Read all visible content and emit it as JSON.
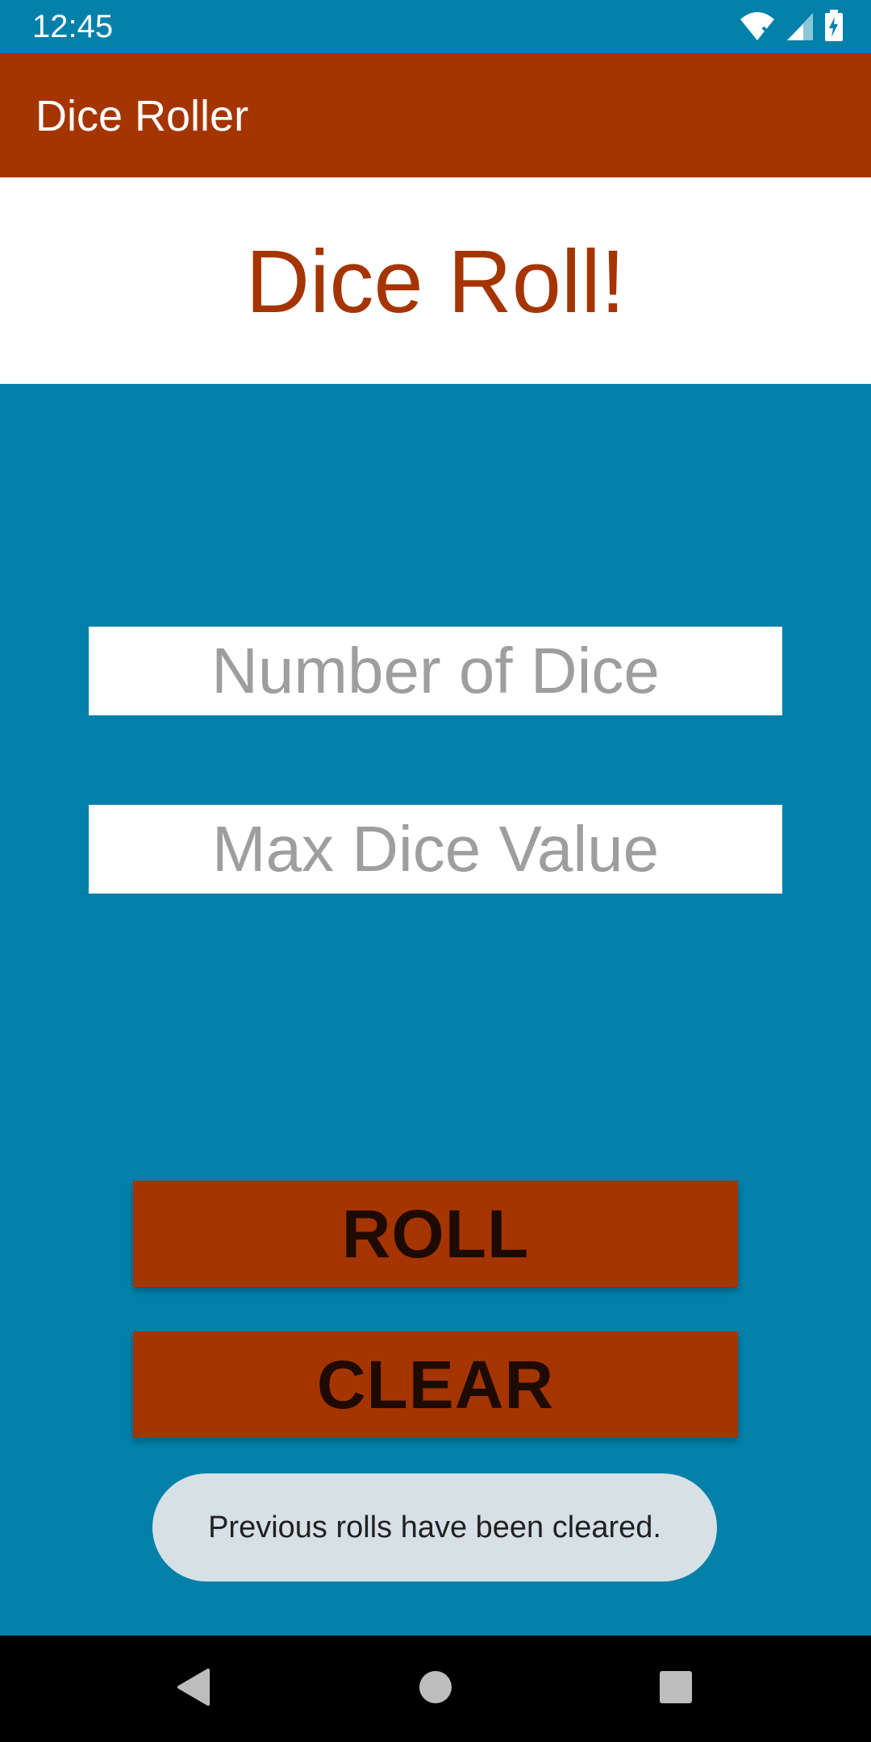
{
  "status_bar": {
    "time": "12:45",
    "icons": [
      "wifi-icon",
      "cell-signal-icon",
      "battery-charging-icon"
    ]
  },
  "app_bar": {
    "title": "Dice Roller"
  },
  "header": {
    "title": "Dice Roll!"
  },
  "form": {
    "number_of_dice": {
      "value": "",
      "placeholder": "Number of Dice"
    },
    "max_dice_value": {
      "value": "",
      "placeholder": "Max Dice Value"
    }
  },
  "buttons": {
    "roll_label": "ROLL",
    "clear_label": "CLEAR"
  },
  "toast": {
    "message": "Previous rolls have been cleared."
  },
  "nav_bar": {
    "icons": [
      "back-icon",
      "home-icon",
      "recents-icon"
    ]
  },
  "colors": {
    "primary": "#A53500",
    "background": "#0180AA",
    "surface": "#FFFFFF",
    "toast": "#D6E0E5",
    "placeholder": "#9E9E9E"
  }
}
